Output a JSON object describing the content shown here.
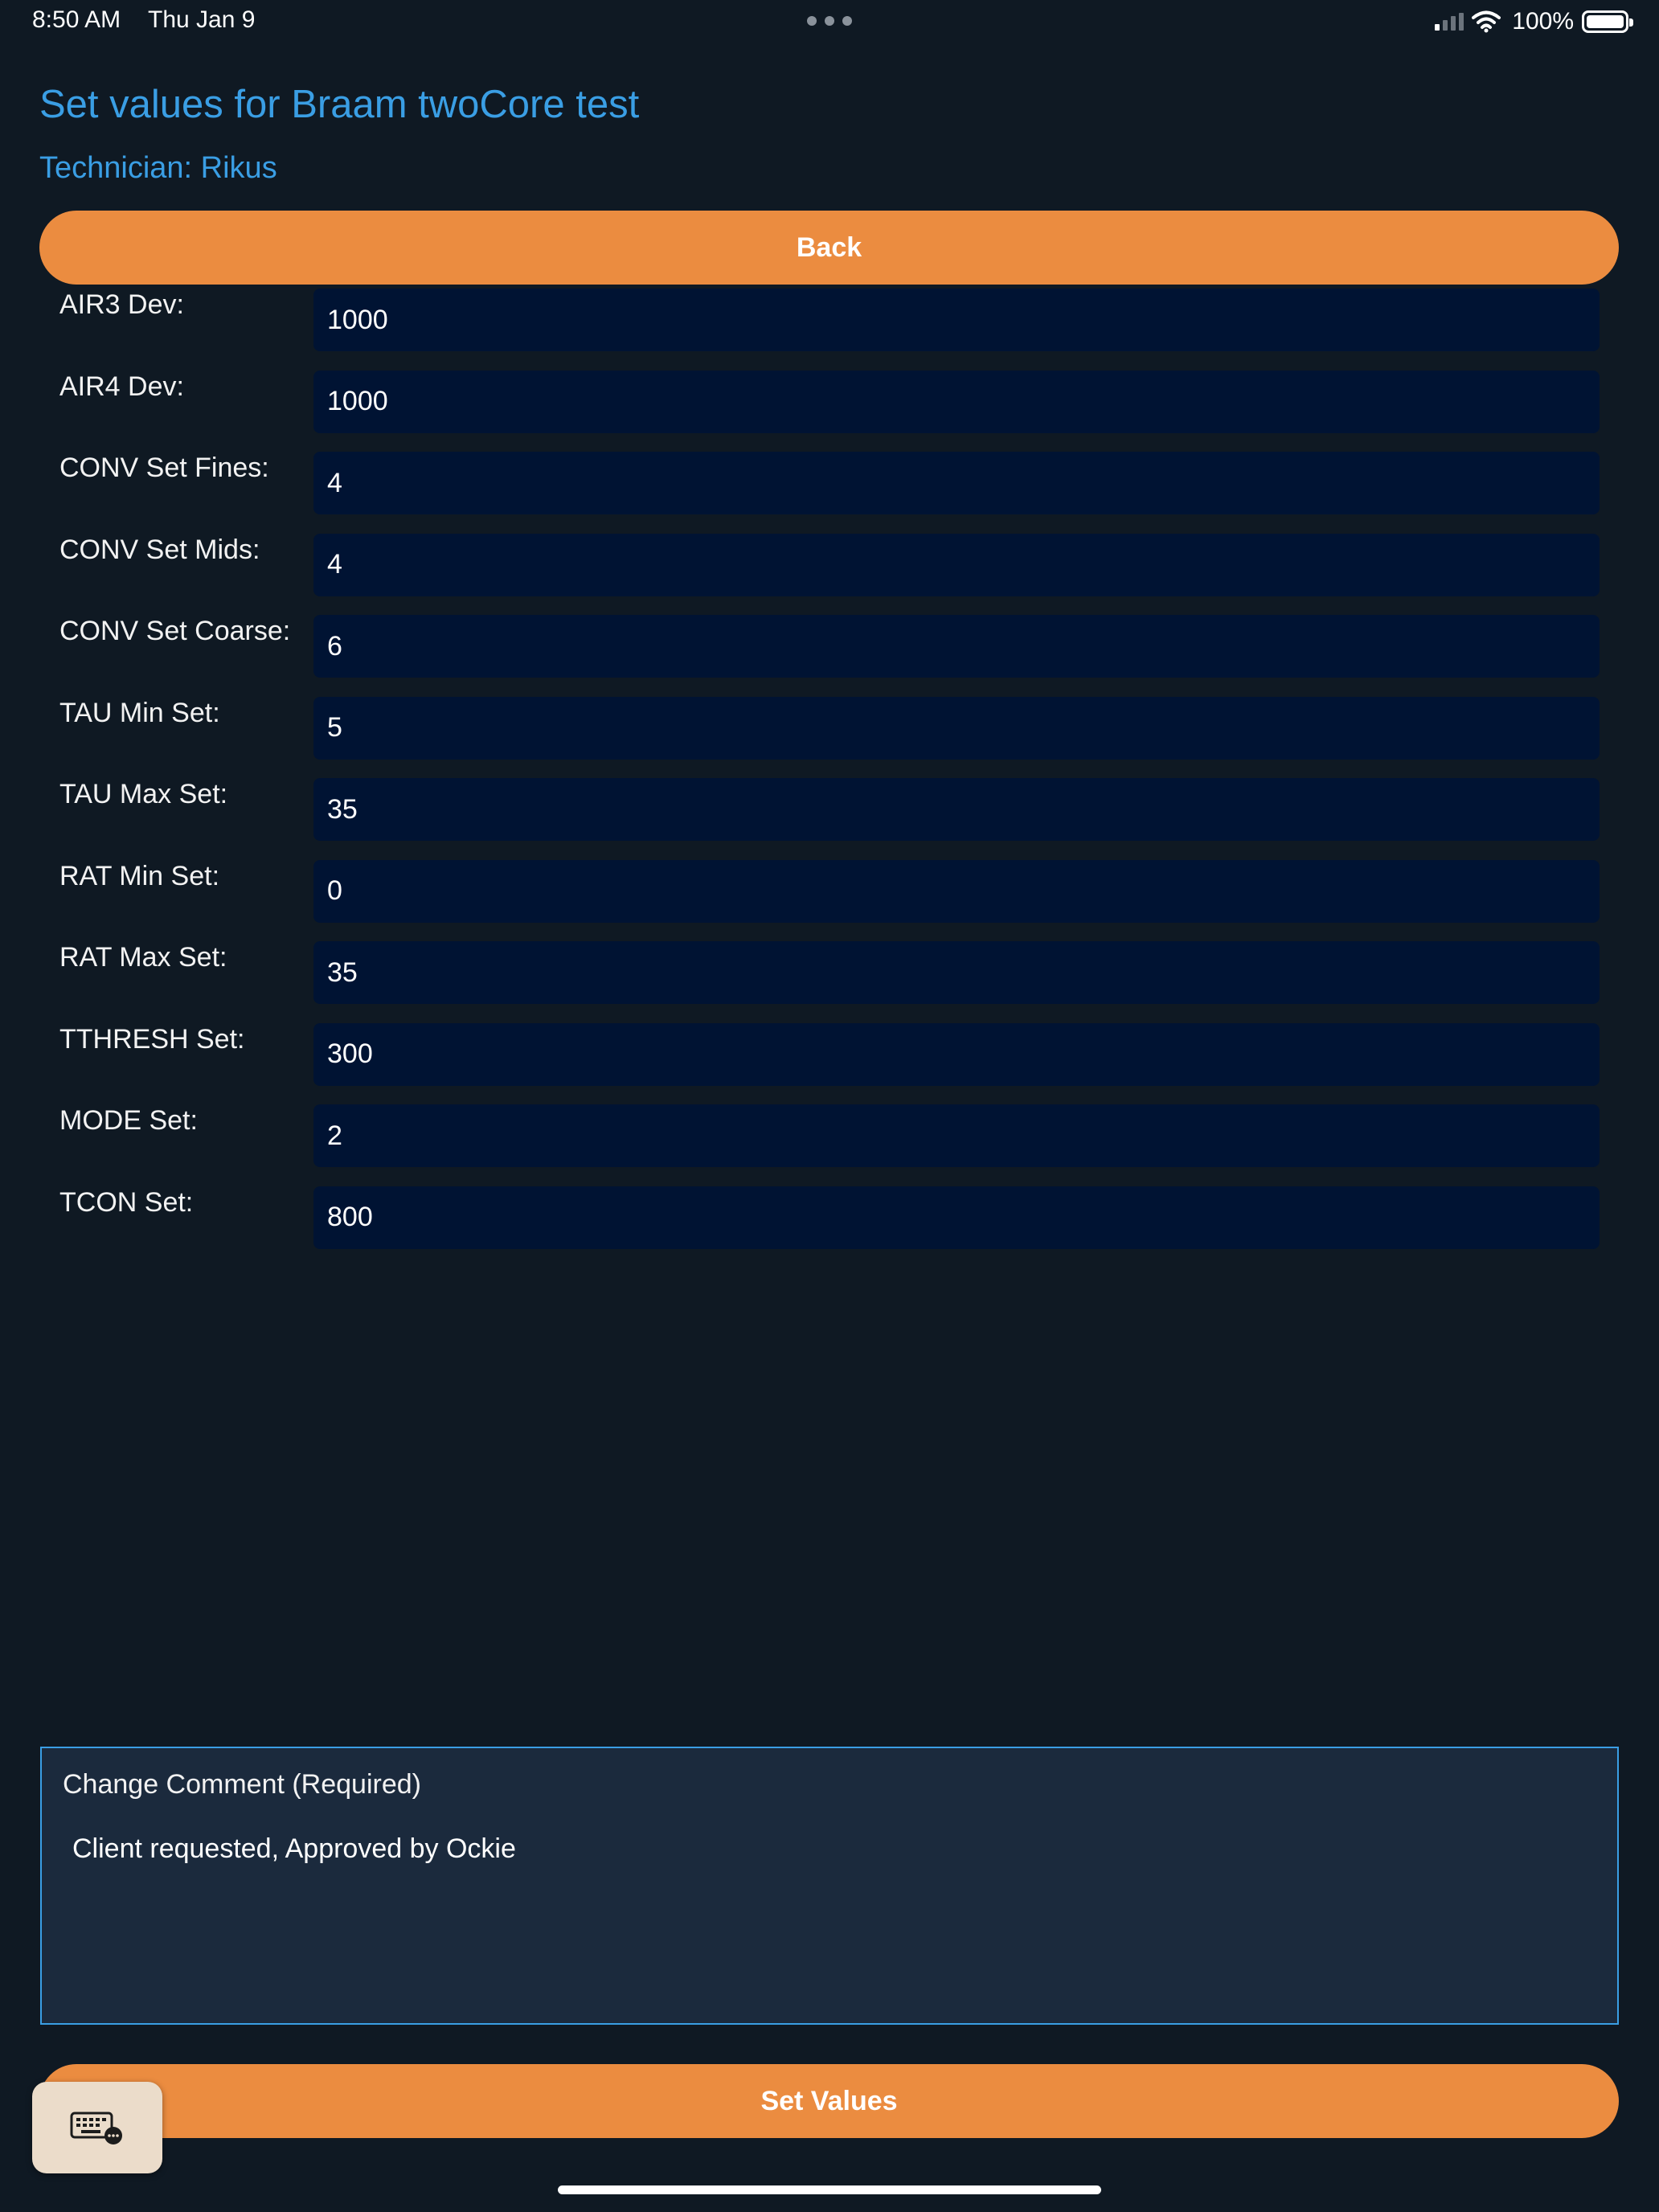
{
  "status_bar": {
    "time": "8:50 AM",
    "date": "Thu Jan 9",
    "battery": "100%",
    "icons": [
      "signal-icon",
      "wifi-icon",
      "battery-icon"
    ]
  },
  "header": {
    "title": "Set values for Braam twoCore test",
    "technician": "Technician: Rikus"
  },
  "buttons": {
    "back": "Back",
    "set_values": "Set Values"
  },
  "fields": [
    {
      "label": "AIR3 Dev:",
      "value": "1000"
    },
    {
      "label": "AIR4 Dev:",
      "value": "1000"
    },
    {
      "label": "CONV Set Fines:",
      "value": "4"
    },
    {
      "label": "CONV Set Mids:",
      "value": "4"
    },
    {
      "label": "CONV Set Coarse:",
      "value": "6"
    },
    {
      "label": "TAU Min Set:",
      "value": "5"
    },
    {
      "label": "TAU Max Set:",
      "value": "35"
    },
    {
      "label": "RAT Min Set:",
      "value": "0"
    },
    {
      "label": "RAT Max Set:",
      "value": "35"
    },
    {
      "label": "TTHRESH Set:",
      "value": "300"
    },
    {
      "label": "MODE Set:",
      "value": "2"
    },
    {
      "label": "TCON Set:",
      "value": "800"
    }
  ],
  "comment": {
    "label": "Change Comment (Required)",
    "value": "Client requested, Approved by Ockie"
  },
  "colors": {
    "background": "#0f1923",
    "accent_blue": "#3a9ee4",
    "button_orange": "#eb8c40",
    "input_bg": "#001333",
    "comment_bg": "#1b2a3d"
  },
  "keyboard_button_icon": "keyboard-icon"
}
